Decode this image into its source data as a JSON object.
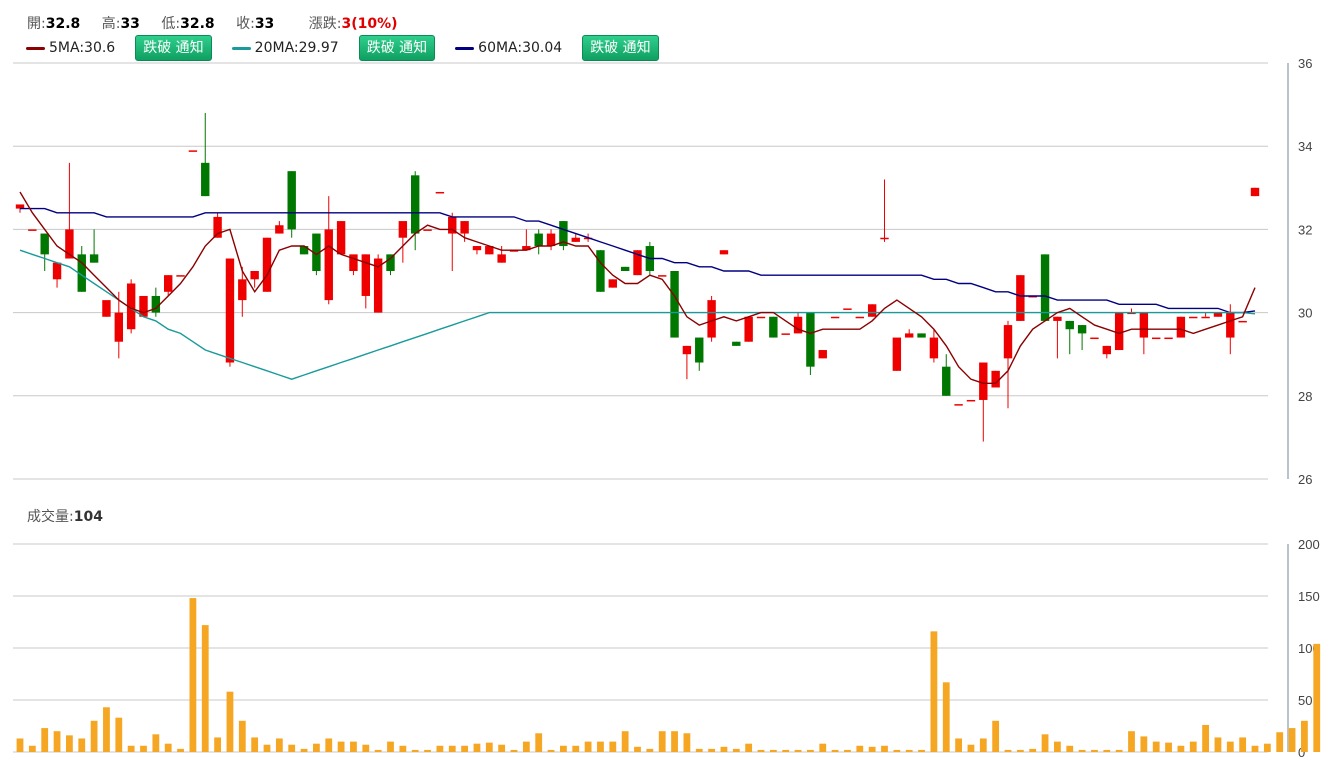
{
  "header": {
    "open_label": "開:",
    "open": "32.8",
    "high_label": "高:",
    "high": "33",
    "low_label": "低:",
    "low": "32.8",
    "close_label": "收:",
    "close": "33",
    "change_label": "漲跌:",
    "change": "3(10%)"
  },
  "ma_legend": [
    {
      "label": "5MA:30.6",
      "color": "#8b0000",
      "button": "跌破 通知"
    },
    {
      "label": "20MA:29.97",
      "color": "#1a9a9a",
      "button": "跌破 通知"
    },
    {
      "label": "60MA:30.04",
      "color": "#000080",
      "button": "跌破 通知"
    }
  ],
  "volume_header": {
    "label": "成交量:",
    "value": "104"
  },
  "colors": {
    "up": "#ee0000",
    "down": "#007700",
    "volume": "#f5a623",
    "grid": "#c8c8c8"
  },
  "chart_data": [
    {
      "type": "candlestick",
      "ylim": [
        26,
        36
      ],
      "yticks": [
        26,
        28,
        30,
        32,
        34,
        36
      ],
      "candles": [
        [
          32.5,
          32.6,
          32.4,
          32.6
        ],
        [
          32.0,
          32.0,
          32.0,
          32.0
        ],
        [
          31.9,
          31.9,
          31.0,
          31.4
        ],
        [
          30.8,
          31.2,
          30.6,
          31.2
        ],
        [
          31.3,
          33.6,
          31.3,
          32.0
        ],
        [
          31.4,
          31.6,
          30.5,
          30.5
        ],
        [
          31.4,
          32.0,
          31.2,
          31.2
        ],
        [
          29.9,
          30.2,
          29.9,
          30.3
        ],
        [
          29.3,
          30.5,
          28.9,
          30.0
        ],
        [
          29.6,
          30.8,
          29.5,
          30.7
        ],
        [
          29.9,
          30.4,
          29.9,
          30.4
        ],
        [
          30.4,
          30.6,
          29.9,
          30.0
        ],
        [
          30.5,
          30.9,
          30.4,
          30.9
        ],
        [
          30.9,
          30.9,
          30.9,
          30.9
        ],
        [
          33.9,
          33.9,
          33.9,
          33.9
        ],
        [
          33.6,
          34.8,
          32.8,
          32.8
        ],
        [
          31.8,
          32.4,
          31.8,
          32.3
        ],
        [
          28.8,
          31.3,
          28.7,
          31.3
        ],
        [
          30.3,
          31.1,
          29.9,
          30.8
        ],
        [
          30.8,
          31.0,
          30.6,
          31.0
        ],
        [
          30.5,
          31.8,
          30.5,
          31.8
        ],
        [
          31.9,
          32.2,
          31.9,
          32.1
        ],
        [
          33.4,
          33.4,
          31.8,
          32.0
        ],
        [
          31.6,
          31.6,
          31.4,
          31.4
        ],
        [
          31.9,
          31.9,
          30.9,
          31.0
        ],
        [
          30.3,
          32.8,
          30.2,
          32.0
        ],
        [
          31.4,
          32.2,
          31.4,
          32.2
        ],
        [
          31.0,
          31.3,
          30.9,
          31.4
        ],
        [
          30.4,
          31.4,
          30.1,
          31.4
        ],
        [
          30.0,
          31.4,
          30.0,
          31.3
        ],
        [
          31.4,
          31.4,
          30.9,
          31.0
        ],
        [
          31.8,
          32.1,
          31.2,
          32.2
        ],
        [
          33.3,
          33.4,
          31.5,
          31.9
        ],
        [
          32.0,
          32.0,
          32.0,
          32.0
        ],
        [
          32.9,
          32.9,
          32.9,
          32.9
        ],
        [
          31.9,
          32.4,
          31.0,
          32.3
        ],
        [
          31.9,
          32.2,
          31.7,
          32.2
        ],
        [
          31.5,
          31.6,
          31.4,
          31.6
        ],
        [
          31.4,
          31.6,
          31.4,
          31.6
        ],
        [
          31.2,
          31.6,
          31.2,
          31.4
        ],
        [
          31.5,
          31.5,
          31.5,
          31.5
        ],
        [
          31.5,
          32.0,
          31.5,
          31.6
        ],
        [
          31.9,
          32.0,
          31.4,
          31.6
        ],
        [
          31.6,
          32.0,
          31.5,
          31.9
        ],
        [
          32.2,
          32.2,
          31.5,
          31.6
        ],
        [
          31.7,
          31.9,
          31.7,
          31.8
        ],
        [
          31.8,
          31.9,
          31.7,
          31.8
        ],
        [
          31.5,
          31.5,
          30.5,
          30.5
        ],
        [
          30.6,
          30.8,
          30.6,
          30.8
        ],
        [
          31.1,
          31.1,
          31.0,
          31.0
        ],
        [
          30.9,
          31.5,
          30.9,
          31.5
        ],
        [
          31.6,
          31.7,
          30.9,
          31.0
        ],
        [
          30.9,
          30.9,
          30.9,
          30.9
        ],
        [
          31.0,
          31.0,
          29.4,
          29.4
        ],
        [
          29.0,
          29.2,
          28.4,
          29.2
        ],
        [
          29.4,
          29.4,
          28.6,
          28.8
        ],
        [
          29.4,
          30.4,
          29.3,
          30.3
        ],
        [
          31.4,
          31.5,
          31.4,
          31.5
        ],
        [
          29.3,
          29.3,
          29.2,
          29.2
        ],
        [
          29.3,
          29.9,
          29.3,
          29.9
        ],
        [
          29.9,
          29.9,
          29.9,
          29.9
        ],
        [
          29.9,
          29.9,
          29.4,
          29.4
        ],
        [
          29.5,
          29.5,
          29.5,
          29.5
        ],
        [
          29.5,
          30.0,
          29.5,
          29.9
        ],
        [
          30.0,
          30.0,
          28.5,
          28.7
        ],
        [
          28.9,
          29.1,
          28.9,
          29.1
        ],
        [
          29.9,
          29.9,
          29.9,
          29.9
        ],
        [
          30.1,
          30.1,
          30.1,
          30.1
        ],
        [
          29.9,
          29.9,
          29.9,
          29.9
        ],
        [
          29.9,
          30.2,
          29.9,
          30.2
        ],
        [
          31.8,
          33.2,
          31.7,
          31.8
        ],
        [
          28.6,
          29.3,
          28.6,
          29.4
        ],
        [
          29.4,
          29.6,
          29.4,
          29.5
        ],
        [
          29.5,
          29.5,
          29.4,
          29.4
        ],
        [
          28.9,
          29.6,
          28.8,
          29.4
        ],
        [
          28.7,
          29.0,
          28.0,
          28.0
        ],
        [
          27.8,
          27.8,
          27.8,
          27.8
        ],
        [
          27.9,
          27.9,
          27.9,
          27.9
        ],
        [
          27.9,
          28.8,
          26.9,
          28.8
        ],
        [
          28.2,
          28.6,
          28.2,
          28.6
        ],
        [
          28.9,
          29.8,
          27.7,
          29.7
        ],
        [
          29.8,
          30.9,
          29.8,
          30.9
        ],
        [
          30.4,
          30.4,
          30.4,
          30.4
        ],
        [
          31.4,
          31.4,
          29.8,
          29.8
        ],
        [
          29.8,
          29.9,
          28.9,
          29.9
        ],
        [
          29.8,
          29.8,
          29.0,
          29.6
        ],
        [
          29.7,
          29.7,
          29.1,
          29.5
        ],
        [
          29.4,
          29.4,
          29.4,
          29.4
        ],
        [
          29.0,
          29.2,
          28.9,
          29.2
        ],
        [
          29.1,
          30.0,
          29.1,
          30.0
        ],
        [
          30.0,
          30.1,
          30.0,
          30.0
        ],
        [
          29.4,
          30.0,
          29.0,
          30.0
        ],
        [
          29.4,
          29.4,
          29.4,
          29.4
        ],
        [
          29.4,
          29.4,
          29.4,
          29.4
        ],
        [
          29.4,
          29.9,
          29.4,
          29.9
        ],
        [
          29.9,
          29.9,
          29.9,
          29.9
        ],
        [
          29.9,
          30.0,
          29.9,
          29.9
        ],
        [
          29.9,
          30.0,
          29.9,
          30.0
        ],
        [
          29.4,
          30.2,
          29.0,
          30.0
        ],
        [
          29.8,
          29.8,
          29.8,
          29.8
        ],
        [
          32.8,
          33.0,
          32.8,
          33.0
        ]
      ],
      "ma5": [
        32.9,
        32.4,
        32.0,
        31.6,
        31.4,
        31.2,
        30.9,
        30.6,
        30.3,
        30.1,
        30.0,
        30.1,
        30.4,
        30.7,
        31.1,
        31.6,
        31.9,
        32.0,
        31.0,
        30.5,
        30.9,
        31.5,
        31.6,
        31.6,
        31.4,
        31.6,
        31.4,
        31.3,
        31.2,
        31.1,
        31.3,
        31.6,
        31.9,
        32.1,
        32.0,
        32.0,
        31.8,
        31.7,
        31.6,
        31.5,
        31.5,
        31.5,
        31.6,
        31.6,
        31.7,
        31.6,
        31.6,
        31.2,
        30.9,
        30.7,
        30.7,
        30.9,
        30.8,
        30.4,
        29.9,
        29.7,
        29.8,
        29.9,
        29.8,
        29.9,
        30.0,
        30.0,
        29.8,
        29.6,
        29.5,
        29.6,
        29.6,
        29.6,
        29.6,
        29.8,
        30.1,
        30.3,
        30.1,
        29.9,
        29.6,
        29.2,
        28.7,
        28.4,
        28.3,
        28.3,
        28.6,
        29.2,
        29.6,
        29.8,
        30.0,
        30.1,
        29.9,
        29.7,
        29.6,
        29.5,
        29.6,
        29.6,
        29.6,
        29.6,
        29.6,
        29.5,
        29.6,
        29.7,
        29.8,
        29.9,
        30.6
      ],
      "ma20": [
        31.5,
        31.4,
        31.3,
        31.2,
        31.1,
        30.9,
        30.7,
        30.5,
        30.3,
        30.1,
        29.9,
        29.8,
        29.6,
        29.5,
        29.3,
        29.1,
        29.0,
        28.9,
        28.8,
        28.7,
        28.6,
        28.5,
        28.4,
        28.5,
        28.6,
        28.7,
        28.8,
        28.9,
        29.0,
        29.1,
        29.2,
        29.3,
        29.4,
        29.5,
        29.6,
        29.7,
        29.8,
        29.9,
        30.0,
        30.0,
        30.0,
        30.0,
        30.0,
        30.0,
        30.0,
        30.0,
        30.0,
        30.0,
        30.0,
        30.0,
        30.0,
        30.0,
        30.0,
        30.0,
        30.0,
        30.0,
        30.0,
        30.0,
        30.0,
        30.0,
        30.0,
        30.0,
        30.0,
        30.0,
        30.0,
        30.0,
        30.0,
        30.0,
        30.0,
        30.0,
        30.0,
        30.0,
        30.0,
        30.0,
        30.0,
        30.0,
        30.0,
        30.0,
        30.0,
        30.0,
        30.0,
        30.0,
        30.0,
        30.0,
        30.0,
        30.0,
        30.0,
        30.0,
        30.0,
        30.0,
        30.0,
        30.0,
        30.0,
        30.0,
        30.0,
        30.0,
        30.0,
        30.0,
        30.0,
        30.0,
        29.97
      ],
      "ma60": [
        32.5,
        32.5,
        32.5,
        32.4,
        32.4,
        32.4,
        32.4,
        32.3,
        32.3,
        32.3,
        32.3,
        32.3,
        32.3,
        32.3,
        32.3,
        32.4,
        32.4,
        32.4,
        32.4,
        32.4,
        32.4,
        32.4,
        32.4,
        32.4,
        32.4,
        32.4,
        32.4,
        32.4,
        32.4,
        32.4,
        32.4,
        32.4,
        32.4,
        32.4,
        32.4,
        32.3,
        32.3,
        32.3,
        32.3,
        32.3,
        32.3,
        32.2,
        32.2,
        32.1,
        32.0,
        31.9,
        31.8,
        31.7,
        31.6,
        31.5,
        31.4,
        31.3,
        31.3,
        31.2,
        31.2,
        31.1,
        31.1,
        31.0,
        31.0,
        31.0,
        30.9,
        30.9,
        30.9,
        30.9,
        30.9,
        30.9,
        30.9,
        30.9,
        30.9,
        30.9,
        30.9,
        30.9,
        30.9,
        30.9,
        30.8,
        30.8,
        30.7,
        30.7,
        30.6,
        30.5,
        30.5,
        30.4,
        30.4,
        30.4,
        30.3,
        30.3,
        30.3,
        30.3,
        30.3,
        30.2,
        30.2,
        30.2,
        30.2,
        30.1,
        30.1,
        30.1,
        30.1,
        30.1,
        30.0,
        30.0,
        30.04
      ]
    },
    {
      "type": "bar",
      "ylim": [
        0,
        200
      ],
      "yticks": [
        0,
        50,
        100,
        150,
        200
      ],
      "values": [
        13,
        6,
        23,
        20,
        16,
        13,
        30,
        43,
        33,
        6,
        6,
        17,
        8,
        3,
        148,
        122,
        14,
        58,
        30,
        14,
        7,
        13,
        7,
        3,
        8,
        13,
        10,
        10,
        7,
        2,
        10,
        6,
        2,
        2,
        6,
        6,
        6,
        8,
        9,
        7,
        2,
        10,
        18,
        2,
        6,
        6,
        10,
        10,
        10,
        20,
        5,
        3,
        20,
        20,
        18,
        3,
        3,
        5,
        3,
        8,
        2,
        2,
        2,
        2,
        2,
        8,
        2,
        2,
        6,
        5,
        6,
        2,
        2,
        2,
        116,
        67,
        13,
        7,
        13,
        30,
        2,
        2,
        3,
        17,
        10,
        6,
        2,
        2,
        2,
        2,
        20,
        15,
        10,
        9,
        6,
        10,
        26,
        14,
        10,
        14,
        6,
        8,
        19,
        23,
        30,
        104
      ]
    }
  ]
}
